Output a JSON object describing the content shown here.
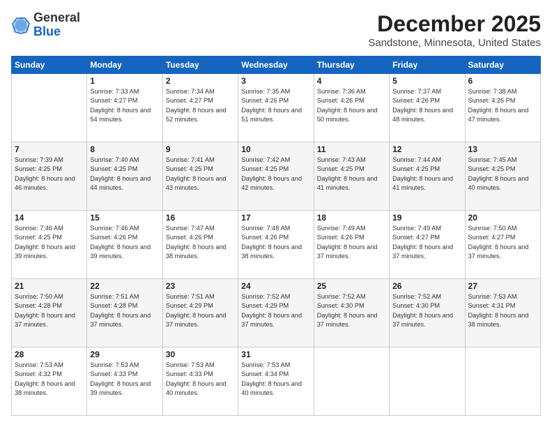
{
  "logo": {
    "general": "General",
    "blue": "Blue"
  },
  "header": {
    "title": "December 2025",
    "subtitle": "Sandstone, Minnesota, United States"
  },
  "days_of_week": [
    "Sunday",
    "Monday",
    "Tuesday",
    "Wednesday",
    "Thursday",
    "Friday",
    "Saturday"
  ],
  "weeks": [
    [
      {
        "day": "",
        "sunrise": "",
        "sunset": "",
        "daylight": ""
      },
      {
        "day": "1",
        "sunrise": "Sunrise: 7:33 AM",
        "sunset": "Sunset: 4:27 PM",
        "daylight": "Daylight: 8 hours and 54 minutes."
      },
      {
        "day": "2",
        "sunrise": "Sunrise: 7:34 AM",
        "sunset": "Sunset: 4:27 PM",
        "daylight": "Daylight: 8 hours and 52 minutes."
      },
      {
        "day": "3",
        "sunrise": "Sunrise: 7:35 AM",
        "sunset": "Sunset: 4:26 PM",
        "daylight": "Daylight: 8 hours and 51 minutes."
      },
      {
        "day": "4",
        "sunrise": "Sunrise: 7:36 AM",
        "sunset": "Sunset: 4:26 PM",
        "daylight": "Daylight: 8 hours and 50 minutes."
      },
      {
        "day": "5",
        "sunrise": "Sunrise: 7:37 AM",
        "sunset": "Sunset: 4:26 PM",
        "daylight": "Daylight: 8 hours and 48 minutes."
      },
      {
        "day": "6",
        "sunrise": "Sunrise: 7:38 AM",
        "sunset": "Sunset: 4:26 PM",
        "daylight": "Daylight: 8 hours and 47 minutes."
      }
    ],
    [
      {
        "day": "7",
        "sunrise": "Sunrise: 7:39 AM",
        "sunset": "Sunset: 4:25 PM",
        "daylight": "Daylight: 8 hours and 46 minutes."
      },
      {
        "day": "8",
        "sunrise": "Sunrise: 7:40 AM",
        "sunset": "Sunset: 4:25 PM",
        "daylight": "Daylight: 8 hours and 44 minutes."
      },
      {
        "day": "9",
        "sunrise": "Sunrise: 7:41 AM",
        "sunset": "Sunset: 4:25 PM",
        "daylight": "Daylight: 8 hours and 43 minutes."
      },
      {
        "day": "10",
        "sunrise": "Sunrise: 7:42 AM",
        "sunset": "Sunset: 4:25 PM",
        "daylight": "Daylight: 8 hours and 42 minutes."
      },
      {
        "day": "11",
        "sunrise": "Sunrise: 7:43 AM",
        "sunset": "Sunset: 4:25 PM",
        "daylight": "Daylight: 8 hours and 41 minutes."
      },
      {
        "day": "12",
        "sunrise": "Sunrise: 7:44 AM",
        "sunset": "Sunset: 4:25 PM",
        "daylight": "Daylight: 8 hours and 41 minutes."
      },
      {
        "day": "13",
        "sunrise": "Sunrise: 7:45 AM",
        "sunset": "Sunset: 4:25 PM",
        "daylight": "Daylight: 8 hours and 40 minutes."
      }
    ],
    [
      {
        "day": "14",
        "sunrise": "Sunrise: 7:46 AM",
        "sunset": "Sunset: 4:25 PM",
        "daylight": "Daylight: 8 hours and 39 minutes."
      },
      {
        "day": "15",
        "sunrise": "Sunrise: 7:46 AM",
        "sunset": "Sunset: 4:26 PM",
        "daylight": "Daylight: 8 hours and 39 minutes."
      },
      {
        "day": "16",
        "sunrise": "Sunrise: 7:47 AM",
        "sunset": "Sunset: 4:26 PM",
        "daylight": "Daylight: 8 hours and 38 minutes."
      },
      {
        "day": "17",
        "sunrise": "Sunrise: 7:48 AM",
        "sunset": "Sunset: 4:26 PM",
        "daylight": "Daylight: 8 hours and 38 minutes."
      },
      {
        "day": "18",
        "sunrise": "Sunrise: 7:49 AM",
        "sunset": "Sunset: 4:26 PM",
        "daylight": "Daylight: 8 hours and 37 minutes."
      },
      {
        "day": "19",
        "sunrise": "Sunrise: 7:49 AM",
        "sunset": "Sunset: 4:27 PM",
        "daylight": "Daylight: 8 hours and 37 minutes."
      },
      {
        "day": "20",
        "sunrise": "Sunrise: 7:50 AM",
        "sunset": "Sunset: 4:27 PM",
        "daylight": "Daylight: 8 hours and 37 minutes."
      }
    ],
    [
      {
        "day": "21",
        "sunrise": "Sunrise: 7:50 AM",
        "sunset": "Sunset: 4:28 PM",
        "daylight": "Daylight: 8 hours and 37 minutes."
      },
      {
        "day": "22",
        "sunrise": "Sunrise: 7:51 AM",
        "sunset": "Sunset: 4:28 PM",
        "daylight": "Daylight: 8 hours and 37 minutes."
      },
      {
        "day": "23",
        "sunrise": "Sunrise: 7:51 AM",
        "sunset": "Sunset: 4:29 PM",
        "daylight": "Daylight: 8 hours and 37 minutes."
      },
      {
        "day": "24",
        "sunrise": "Sunrise: 7:52 AM",
        "sunset": "Sunset: 4:29 PM",
        "daylight": "Daylight: 8 hours and 37 minutes."
      },
      {
        "day": "25",
        "sunrise": "Sunrise: 7:52 AM",
        "sunset": "Sunset: 4:30 PM",
        "daylight": "Daylight: 8 hours and 37 minutes."
      },
      {
        "day": "26",
        "sunrise": "Sunrise: 7:52 AM",
        "sunset": "Sunset: 4:30 PM",
        "daylight": "Daylight: 8 hours and 37 minutes."
      },
      {
        "day": "27",
        "sunrise": "Sunrise: 7:53 AM",
        "sunset": "Sunset: 4:31 PM",
        "daylight": "Daylight: 8 hours and 38 minutes."
      }
    ],
    [
      {
        "day": "28",
        "sunrise": "Sunrise: 7:53 AM",
        "sunset": "Sunset: 4:32 PM",
        "daylight": "Daylight: 8 hours and 38 minutes."
      },
      {
        "day": "29",
        "sunrise": "Sunrise: 7:53 AM",
        "sunset": "Sunset: 4:33 PM",
        "daylight": "Daylight: 8 hours and 39 minutes."
      },
      {
        "day": "30",
        "sunrise": "Sunrise: 7:53 AM",
        "sunset": "Sunset: 4:33 PM",
        "daylight": "Daylight: 8 hours and 40 minutes."
      },
      {
        "day": "31",
        "sunrise": "Sunrise: 7:53 AM",
        "sunset": "Sunset: 4:34 PM",
        "daylight": "Daylight: 8 hours and 40 minutes."
      },
      {
        "day": "",
        "sunrise": "",
        "sunset": "",
        "daylight": ""
      },
      {
        "day": "",
        "sunrise": "",
        "sunset": "",
        "daylight": ""
      },
      {
        "day": "",
        "sunrise": "",
        "sunset": "",
        "daylight": ""
      }
    ]
  ]
}
